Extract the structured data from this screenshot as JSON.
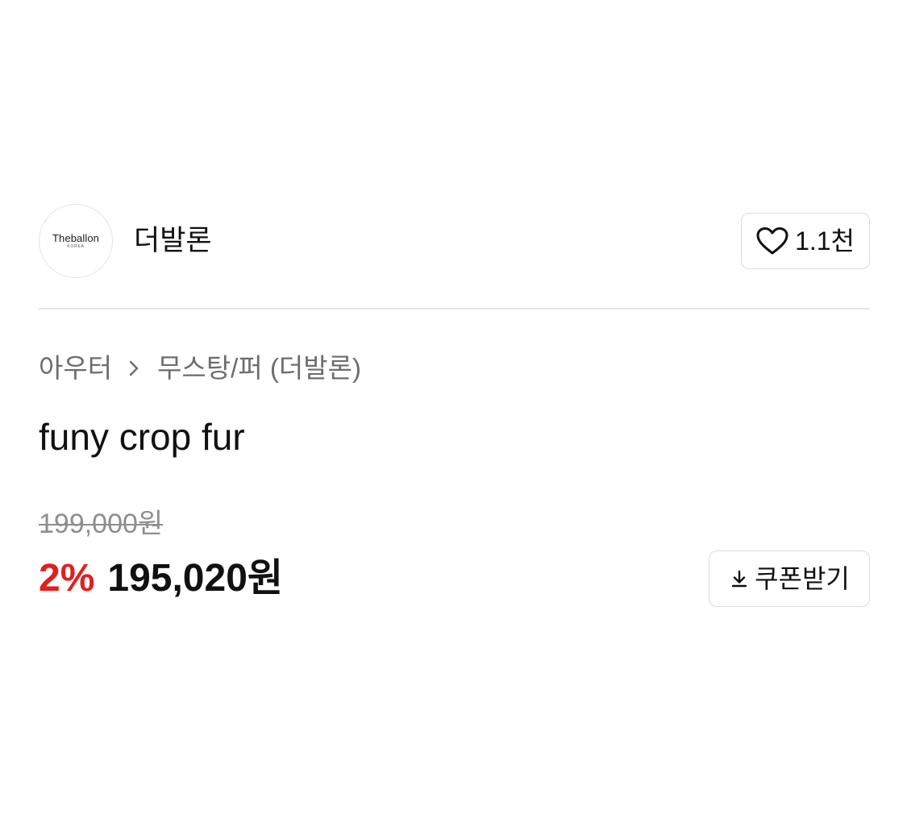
{
  "brand": {
    "logo_text": "Theballon",
    "logo_subtext": "KOREA",
    "name": "더발론",
    "like_icon": "heart-outline-icon",
    "like_count": "1.1천"
  },
  "breadcrumb": {
    "items": [
      "아우터",
      "무스탕/퍼 (더발론)"
    ],
    "separator_icon": "chevron-right-icon"
  },
  "product": {
    "title": "funy crop fur"
  },
  "price": {
    "original": "199,000원",
    "discount_rate": "2%",
    "sale": "195,020원"
  },
  "coupon": {
    "icon": "download-icon",
    "label": "쿠폰받기"
  },
  "colors": {
    "discount": "#e41e1e",
    "text": "#111111",
    "muted": "#6d6d6d",
    "border": "#dcdcdc"
  }
}
